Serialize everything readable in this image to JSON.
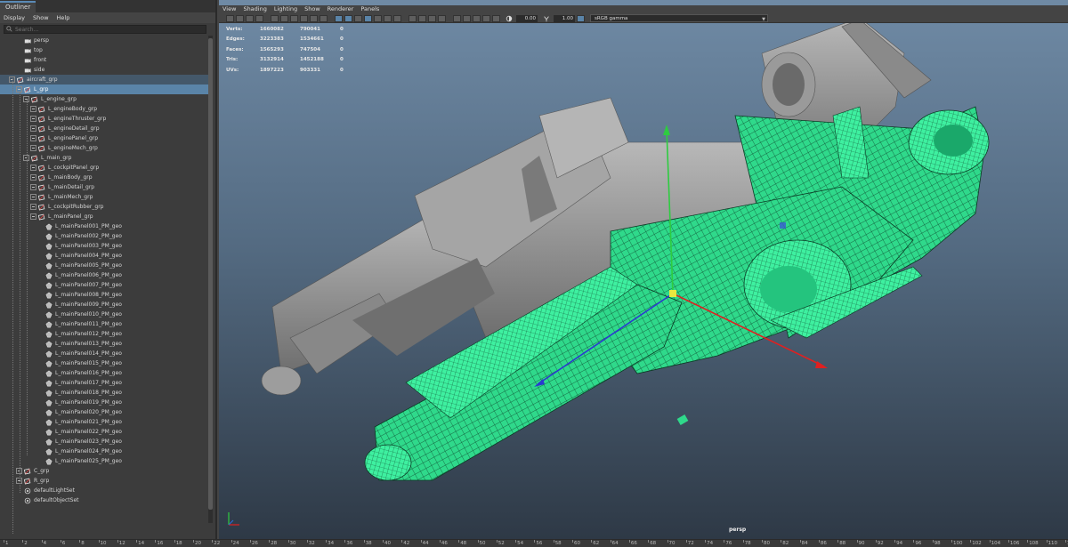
{
  "outliner": {
    "tab_label": "Outliner",
    "menu": [
      "Display",
      "Show",
      "Help"
    ],
    "search_placeholder": "Search...",
    "items": [
      {
        "label": "persp",
        "depth": 1,
        "icon": "camera"
      },
      {
        "label": "top",
        "depth": 1,
        "icon": "camera"
      },
      {
        "label": "front",
        "depth": 1,
        "icon": "camera"
      },
      {
        "label": "side",
        "depth": 1,
        "icon": "camera"
      },
      {
        "label": "aircraft_grp",
        "depth": 0,
        "icon": "group",
        "expander": true,
        "state": "selected-parent"
      },
      {
        "label": "L_grp",
        "depth": 1,
        "icon": "group",
        "expander": true,
        "state": "selected"
      },
      {
        "label": "L_engine_grp",
        "depth": 2,
        "icon": "group",
        "expander": true
      },
      {
        "label": "L_engineBody_grp",
        "depth": 3,
        "icon": "group",
        "expander": true
      },
      {
        "label": "L_engineThruster_grp",
        "depth": 3,
        "icon": "group",
        "expander": true
      },
      {
        "label": "L_engineDetail_grp",
        "depth": 3,
        "icon": "group",
        "expander": true
      },
      {
        "label": "L_enginePanel_grp",
        "depth": 3,
        "icon": "group",
        "expander": true
      },
      {
        "label": "L_engineMech_grp",
        "depth": 3,
        "icon": "group",
        "expander": true
      },
      {
        "label": "L_main_grp",
        "depth": 2,
        "icon": "group",
        "expander": true
      },
      {
        "label": "L_cockpitPanel_grp",
        "depth": 3,
        "icon": "group",
        "expander": true
      },
      {
        "label": "L_mainBody_grp",
        "depth": 3,
        "icon": "group",
        "expander": true
      },
      {
        "label": "L_mainDetail_grp",
        "depth": 3,
        "icon": "group",
        "expander": true
      },
      {
        "label": "L_mainMech_grp",
        "depth": 3,
        "icon": "group",
        "expander": true
      },
      {
        "label": "L_cockpitRubber_grp",
        "depth": 3,
        "icon": "group",
        "expander": true
      },
      {
        "label": "L_mainPanel_grp",
        "depth": 3,
        "icon": "group",
        "expander": true
      },
      {
        "label": "L_mainPanel001_PM_geo",
        "depth": 4,
        "icon": "mesh"
      },
      {
        "label": "L_mainPanel002_PM_geo",
        "depth": 4,
        "icon": "mesh"
      },
      {
        "label": "L_mainPanel003_PM_geo",
        "depth": 4,
        "icon": "mesh"
      },
      {
        "label": "L_mainPanel004_PM_geo",
        "depth": 4,
        "icon": "mesh"
      },
      {
        "label": "L_mainPanel005_PM_geo",
        "depth": 4,
        "icon": "mesh"
      },
      {
        "label": "L_mainPanel006_PM_geo",
        "depth": 4,
        "icon": "mesh"
      },
      {
        "label": "L_mainPanel007_PM_geo",
        "depth": 4,
        "icon": "mesh"
      },
      {
        "label": "L_mainPanel008_PM_geo",
        "depth": 4,
        "icon": "mesh"
      },
      {
        "label": "L_mainPanel009_PM_geo",
        "depth": 4,
        "icon": "mesh"
      },
      {
        "label": "L_mainPanel010_PM_geo",
        "depth": 4,
        "icon": "mesh"
      },
      {
        "label": "L_mainPanel011_PM_geo",
        "depth": 4,
        "icon": "mesh"
      },
      {
        "label": "L_mainPanel012_PM_geo",
        "depth": 4,
        "icon": "mesh"
      },
      {
        "label": "L_mainPanel013_PM_geo",
        "depth": 4,
        "icon": "mesh"
      },
      {
        "label": "L_mainPanel014_PM_geo",
        "depth": 4,
        "icon": "mesh"
      },
      {
        "label": "L_mainPanel015_PM_geo",
        "depth": 4,
        "icon": "mesh"
      },
      {
        "label": "L_mainPanel016_PM_geo",
        "depth": 4,
        "icon": "mesh"
      },
      {
        "label": "L_mainPanel017_PM_geo",
        "depth": 4,
        "icon": "mesh"
      },
      {
        "label": "L_mainPanel018_PM_geo",
        "depth": 4,
        "icon": "mesh"
      },
      {
        "label": "L_mainPanel019_PM_geo",
        "depth": 4,
        "icon": "mesh"
      },
      {
        "label": "L_mainPanel020_PM_geo",
        "depth": 4,
        "icon": "mesh"
      },
      {
        "label": "L_mainPanel021_PM_geo",
        "depth": 4,
        "icon": "mesh"
      },
      {
        "label": "L_mainPanel022_PM_geo",
        "depth": 4,
        "icon": "mesh"
      },
      {
        "label": "L_mainPanel023_PM_geo",
        "depth": 4,
        "icon": "mesh"
      },
      {
        "label": "L_mainPanel024_PM_geo",
        "depth": 4,
        "icon": "mesh"
      },
      {
        "label": "L_mainPanel025_PM_geo",
        "depth": 4,
        "icon": "mesh"
      },
      {
        "label": "C_grp",
        "depth": 1,
        "icon": "group",
        "expander": true
      },
      {
        "label": "R_grp",
        "depth": 1,
        "icon": "group",
        "expander": true
      },
      {
        "label": "defaultLightSet",
        "depth": 1,
        "icon": "set"
      },
      {
        "label": "defaultObjectSet",
        "depth": 1,
        "icon": "set"
      }
    ]
  },
  "viewport": {
    "menu": [
      "View",
      "Shading",
      "Lighting",
      "Show",
      "Renderer",
      "Panels"
    ],
    "exposure": "0.00",
    "gamma": "1.00",
    "color_space": "sRGB gamma",
    "camera_label": "persp",
    "hud": [
      {
        "label": "Verts:",
        "total": "1660082",
        "selected": "790041",
        "component": "0"
      },
      {
        "label": "Edges:",
        "total": "3223383",
        "selected": "1534661",
        "component": "0"
      },
      {
        "label": "Faces:",
        "total": "1565293",
        "selected": "747504",
        "component": "0"
      },
      {
        "label": "Tris:",
        "total": "3132914",
        "selected": "1452188",
        "component": "0"
      },
      {
        "label": "UVs:",
        "total": "1897223",
        "selected": "903331",
        "component": "0"
      }
    ]
  },
  "timeline": {
    "ticks": [
      "1",
      "2",
      "4",
      "6",
      "8",
      "10",
      "12",
      "14",
      "16",
      "18",
      "20",
      "22",
      "24",
      "26",
      "28",
      "30",
      "32",
      "34",
      "36",
      "38",
      "40",
      "42",
      "44",
      "46",
      "48",
      "50",
      "52",
      "54",
      "56",
      "58",
      "60",
      "62",
      "64",
      "66",
      "68",
      "70",
      "72",
      "74",
      "76",
      "78",
      "80",
      "82",
      "84",
      "86",
      "88",
      "90",
      "92",
      "94",
      "96",
      "98",
      "100",
      "102",
      "104",
      "106",
      "108",
      "110",
      "112"
    ]
  },
  "colors": {
    "selection": "#5a84a8",
    "wireframe": "#3ef0a0",
    "accent_tab": "#5a8ab5"
  }
}
